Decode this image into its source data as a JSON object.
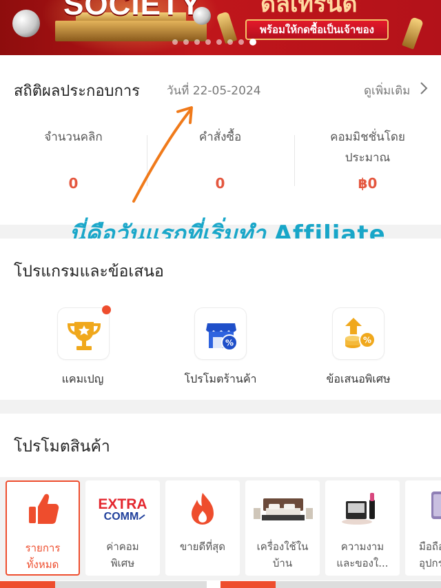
{
  "banner": {
    "title_text": "SOCIETY",
    "headline_thai": "ดีลเทรนด์",
    "cta_text": "พร้อมให้กดซื้อเป็นเจ้าของ",
    "slides": 8,
    "active_slide": 8
  },
  "stats": {
    "title": "สถิติผลประกอบการ",
    "date": "วันที่ 22-05-2024",
    "see_more": "ดูเพิ่มเติม",
    "columns": [
      {
        "label": "จำนวนคลิก",
        "value": "0"
      },
      {
        "label": "คำสั่งซื้อ",
        "value": "0"
      },
      {
        "label": "คอมมิชชั่นโดย\nประมาณ",
        "value": "฿0"
      }
    ]
  },
  "annotation": {
    "thai": "นี่คือวันแรกที่เริ่มทำ",
    "english": "Affiliate"
  },
  "programs": {
    "title": "โปรแกรมและข้อเสนอ",
    "items": [
      {
        "label": "แคมเปญ",
        "icon": "trophy-icon",
        "has_badge": true
      },
      {
        "label": "โปรโมตร้านค้า",
        "icon": "store-discount-icon",
        "has_badge": false
      },
      {
        "label": "ข้อเสนอพิเศษ",
        "icon": "coin-up-discount-icon",
        "has_badge": false
      }
    ]
  },
  "promo": {
    "title": "โปรโมตสินค้า",
    "extra_logo_top": "EXTRA",
    "extra_logo_bottom": "COMM",
    "tiles": [
      {
        "label": "รายการ\nทั้งหมด",
        "icon": "thumbs-up-icon",
        "active": true
      },
      {
        "label": "ค่าคอม\nพิเศษ",
        "icon": "extra-comm-logo",
        "active": false
      },
      {
        "label": "ขายดีที่สุด",
        "icon": "flame-icon",
        "active": false
      },
      {
        "label": "เครื่องใช้ใน\nบ้าน",
        "icon": "bed-icon",
        "active": false
      },
      {
        "label": "ความงาม\nและของใ...",
        "icon": "cosmetics-icon",
        "active": false
      },
      {
        "label": "มือถือ\nอุปกร",
        "icon": "phone-icon",
        "active": false
      }
    ]
  },
  "colors": {
    "accent": "#ee4d2d",
    "stat_value": "#e4573f",
    "annotation": "#1aa7c9",
    "arrow": "#f07a1a"
  }
}
